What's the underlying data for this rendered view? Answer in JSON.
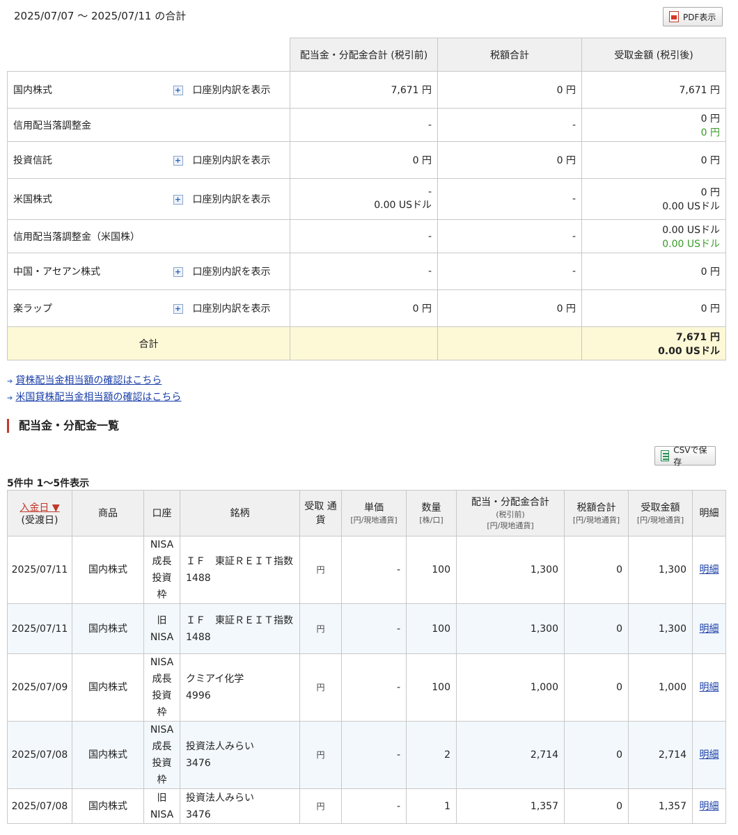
{
  "period_title": "2025/07/07 ～ 2025/07/11 の合計",
  "buttons": {
    "pdf": "PDF表示",
    "csv": "CSVで保存"
  },
  "summary": {
    "headers": [
      "配当金・分配金合計 (税引前)",
      "税額合計",
      "受取金額 (税引後)"
    ],
    "toggle_label": "口座別内訳を表示",
    "rows": [
      {
        "label": "国内株式",
        "pre": "7,671 円",
        "tax": "0 円",
        "post": "7,671 円"
      },
      {
        "label": "信用配当落調整金",
        "pre": "-",
        "tax": "-",
        "post": "0 円",
        "post2": "0 円"
      },
      {
        "label": "投資信託",
        "pre": "0 円",
        "tax": "0 円",
        "post": "0 円"
      },
      {
        "label": "米国株式",
        "pre": "-",
        "pre2": "0.00 USドル",
        "tax": "-",
        "post": "0 円",
        "post2": "0.00 USドル"
      },
      {
        "label": "信用配当落調整金（米国株）",
        "pre": "-",
        "tax": "-",
        "post": "0.00 USドル",
        "post2": "0.00 USドル"
      },
      {
        "label": "中国・アセアン株式",
        "pre": "-",
        "tax": "-",
        "post": "0 円"
      },
      {
        "label": "楽ラップ",
        "pre": "0 円",
        "tax": "0 円",
        "post": "0 円"
      }
    ],
    "total": {
      "label": "合計",
      "post": "7,671 円",
      "post2": "0.00 USドル"
    }
  },
  "links": [
    "貸株配当金相当額の確認はこちら",
    "米国貸株配当金相当額の確認はこちら"
  ],
  "section_title": "配当金・分配金一覧",
  "count_text": "5件中 1〜5件表示",
  "list": {
    "headers": {
      "date": "入金日 ▼",
      "date_sub": "(受渡日)",
      "product": "商品",
      "account": "口座",
      "name": "銘柄",
      "currency": "受取 通貨",
      "unit": "単価",
      "unit_sub": "[円/現地通貨]",
      "qty": "数量",
      "qty_sub": "[株/口]",
      "pre": "配当・分配金合計",
      "pre_sub": "(税引前)",
      "pre_sub2": "[円/現地通貨]",
      "tax": "税額合計",
      "tax_sub": "[円/現地通貨]",
      "post": "受取金額",
      "post_sub": "[円/現地通貨]",
      "detail": "明細"
    },
    "rows": [
      {
        "date": "2025/07/11",
        "product": "国内株式",
        "account": "NISA 成長 投資 枠",
        "name": "ＩＦ　東証ＲＥＩＴ指数",
        "code": "1488",
        "currency": "円",
        "unit": "-",
        "qty": "100",
        "pre": "1,300",
        "tax": "0",
        "post": "1,300",
        "detail": "明細"
      },
      {
        "date": "2025/07/11",
        "product": "国内株式",
        "account": "旧 NISA",
        "name": "ＩＦ　東証ＲＥＩＴ指数",
        "code": "1488",
        "currency": "円",
        "unit": "-",
        "qty": "100",
        "pre": "1,300",
        "tax": "0",
        "post": "1,300",
        "detail": "明細"
      },
      {
        "date": "2025/07/09",
        "product": "国内株式",
        "account": "NISA 成長 投資 枠",
        "name": "クミアイ化学",
        "code": "4996",
        "currency": "円",
        "unit": "-",
        "qty": "100",
        "pre": "1,000",
        "tax": "0",
        "post": "1,000",
        "detail": "明細"
      },
      {
        "date": "2025/07/08",
        "product": "国内株式",
        "account": "NISA 成長 投資 枠",
        "name": "投資法人みらい",
        "code": "3476",
        "currency": "円",
        "unit": "-",
        "qty": "2",
        "pre": "2,714",
        "tax": "0",
        "post": "2,714",
        "detail": "明細"
      },
      {
        "date": "2025/07/08",
        "product": "国内株式",
        "account": "旧 NISA",
        "name": "投資法人みらい",
        "code": "3476",
        "currency": "円",
        "unit": "-",
        "qty": "1",
        "pre": "1,357",
        "tax": "0",
        "post": "1,357",
        "detail": "明細"
      }
    ]
  }
}
